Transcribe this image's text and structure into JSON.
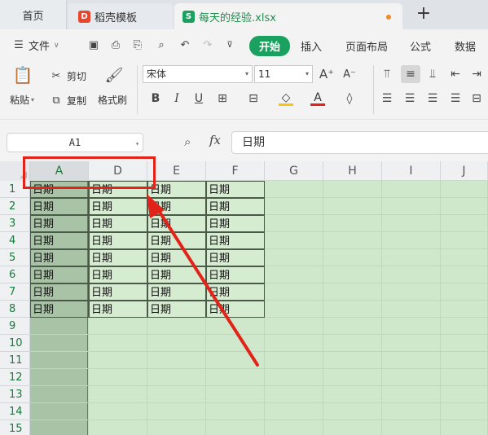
{
  "tabs": {
    "home": "首页",
    "docer": "稻壳模板",
    "docer_logo": "D",
    "file": "每天的经验.xlsx",
    "file_logo": "S",
    "new_tab": "+"
  },
  "menu": {
    "file": "文件",
    "start": "开始",
    "insert": "插入",
    "page_layout": "页面布局",
    "formula": "公式",
    "data": "数据"
  },
  "ribbon": {
    "paste": "粘贴",
    "cut": "剪切",
    "copy": "复制",
    "format_painter": "格式刷",
    "font_name": "宋体",
    "font_size": "11",
    "bold": "B",
    "italic": "I",
    "underline": "U"
  },
  "formula_bar": {
    "name_box": "A1",
    "fx": "fx",
    "value": "日期"
  },
  "columns": [
    "A",
    "D",
    "E",
    "F",
    "G",
    "H",
    "I",
    "J"
  ],
  "rows": [
    "1",
    "2",
    "3",
    "4",
    "5",
    "6",
    "7",
    "8",
    "9",
    "10",
    "11",
    "12",
    "13",
    "14",
    "15"
  ],
  "cell_text": "日期",
  "colors": {
    "accent": "#1aa15f",
    "annotation": "#e2231a",
    "sheet_bg": "#cfe8cc"
  }
}
